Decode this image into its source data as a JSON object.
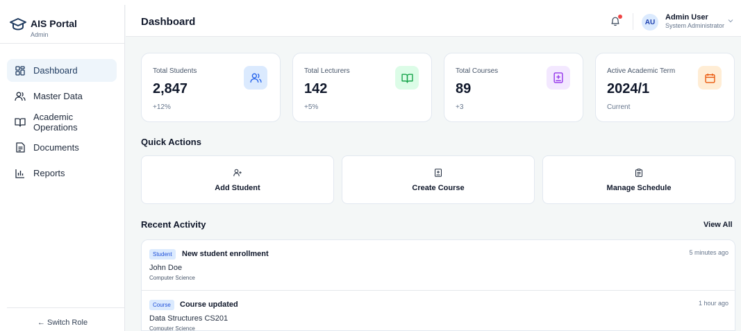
{
  "brand": {
    "title": "AIS Portal",
    "subtitle": "Admin"
  },
  "sidebar": {
    "items": [
      {
        "label": "Dashboard",
        "icon": "grid-icon",
        "active": true
      },
      {
        "label": "Master Data",
        "icon": "users-icon",
        "active": false
      },
      {
        "label": "Academic Operations",
        "icon": "book-open-icon",
        "active": false
      },
      {
        "label": "Documents",
        "icon": "file-text-icon",
        "active": false
      },
      {
        "label": "Reports",
        "icon": "bar-chart-icon",
        "active": false
      }
    ],
    "switch_role": "← Switch Role"
  },
  "header": {
    "title": "Dashboard",
    "user": {
      "initials": "AU",
      "name": "Admin User",
      "role": "System Administrator"
    }
  },
  "stats": [
    {
      "label": "Total Students",
      "value": "2,847",
      "delta": "+12%",
      "icon": "users-icon",
      "color": "#2563eb",
      "bg": "#dbeafe"
    },
    {
      "label": "Total Lecturers",
      "value": "142",
      "delta": "+5%",
      "icon": "book-open-icon",
      "color": "#16a34a",
      "bg": "#dcfce7"
    },
    {
      "label": "Total Courses",
      "value": "89",
      "delta": "+3",
      "icon": "book-plus-icon",
      "color": "#9333ea",
      "bg": "#f3e8ff"
    },
    {
      "label": "Active Academic Term",
      "value": "2024/1",
      "delta": "Current",
      "icon": "calendar-icon",
      "color": "#ea580c",
      "bg": "#ffedd5"
    }
  ],
  "quick_actions": {
    "title": "Quick Actions",
    "items": [
      {
        "label": "Add Student",
        "icon": "user-plus-icon"
      },
      {
        "label": "Create Course",
        "icon": "book-plus-icon"
      },
      {
        "label": "Manage Schedule",
        "icon": "clipboard-icon"
      }
    ]
  },
  "recent_activity": {
    "title": "Recent Activity",
    "view_all": "View All",
    "items": [
      {
        "tag": "Student",
        "title": "New student enrollment",
        "name": "John Doe",
        "dept": "Computer Science",
        "time": "5 minutes ago"
      },
      {
        "tag": "Course",
        "title": "Course updated",
        "name": "Data Structures CS201",
        "dept": "Computer Science",
        "time": "1 hour ago"
      }
    ]
  },
  "colors": {
    "accent": "#1e3a5f",
    "active_bg": "#eef5fb",
    "tag_bg": "#dbeafe",
    "notification": "#ef4444"
  }
}
